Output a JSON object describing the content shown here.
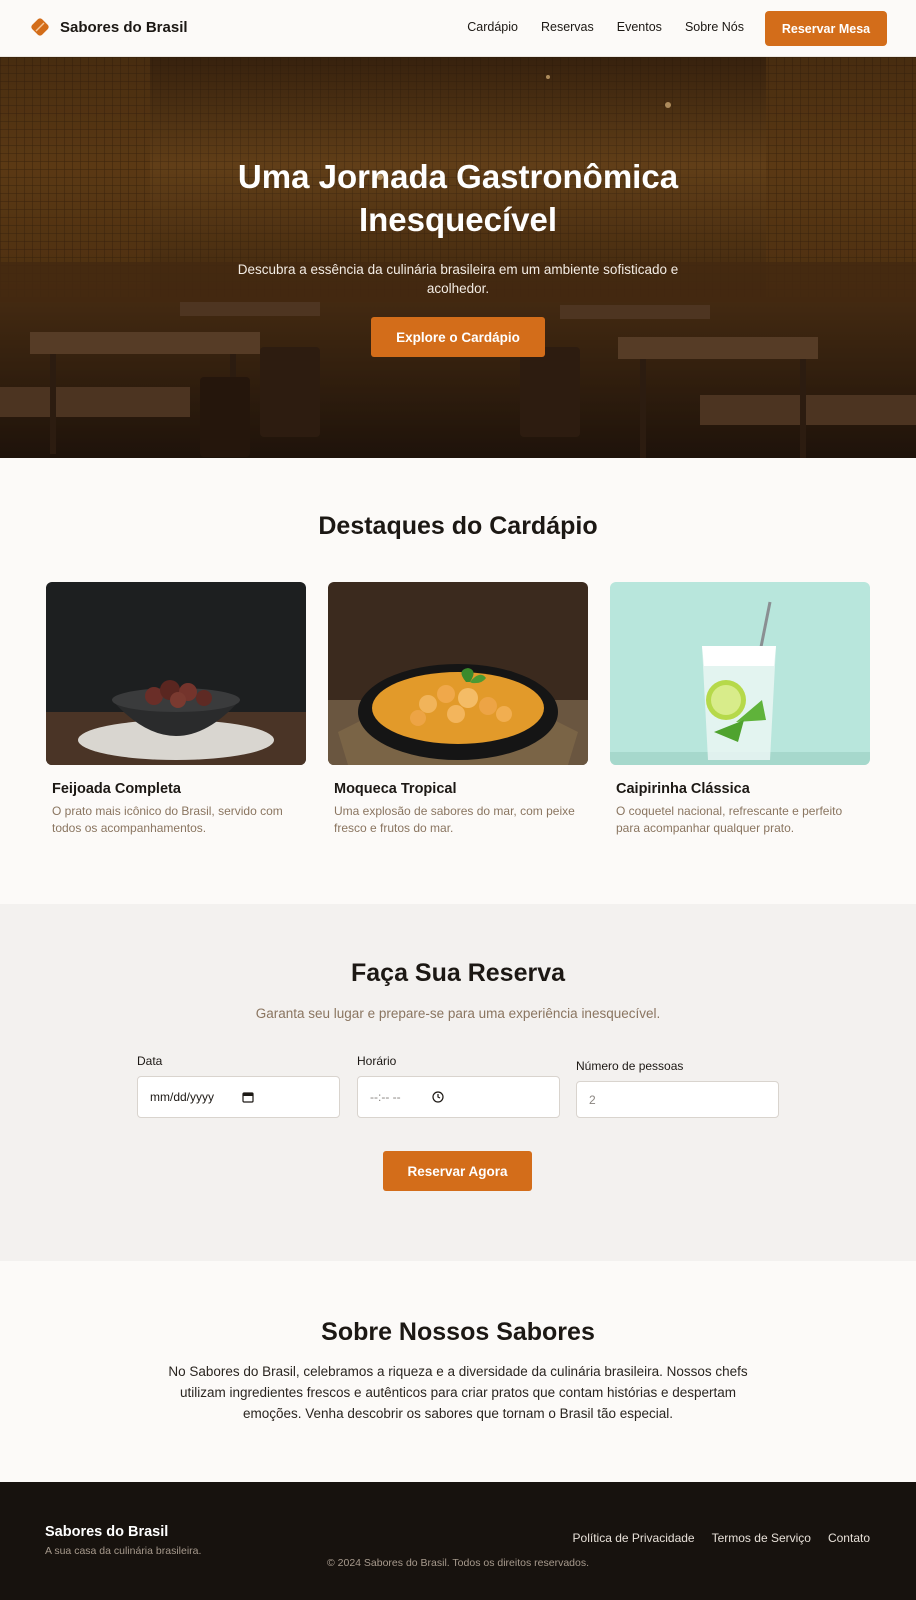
{
  "header": {
    "brand": "Sabores do Brasil",
    "nav": [
      "Cardápio",
      "Reservas",
      "Eventos",
      "Sobre Nós"
    ],
    "cta": "Reservar Mesa"
  },
  "hero": {
    "title_line1": "Uma Jornada Gastronômica",
    "title_line2": "Inesquecível",
    "subtitle": "Descubra a essência da culinária brasileira em um ambiente sofisticado e acolhedor.",
    "cta": "Explore o Cardápio"
  },
  "highlights": {
    "title": "Destaques do Cardápio",
    "items": [
      {
        "name": "Feijoada Completa",
        "description": "O prato mais icônico do Brasil, servido com todos os acompanhamentos."
      },
      {
        "name": "Moqueca Tropical",
        "description": "Uma explosão de sabores do mar, com peixe fresco e frutos do mar."
      },
      {
        "name": "Caipirinha Clássica",
        "description": "O coquetel nacional, refrescante e perfeito para acompanhar qualquer prato."
      }
    ]
  },
  "reservation": {
    "title": "Faça Sua Reserva",
    "subtitle": "Garanta seu lugar e prepare-se para uma experiência inesquecível.",
    "date_label": "Data",
    "date_placeholder": "mm/dd/yyyy",
    "time_label": "Horário",
    "time_placeholder": "--:-- --",
    "people_label": "Número de pessoas",
    "people_placeholder": "2",
    "submit": "Reservar Agora"
  },
  "about": {
    "title": "Sobre Nossos Sabores",
    "text": "No Sabores do Brasil, celebramos a riqueza e a diversidade da culinária brasileira. Nossos chefs utilizam ingredientes frescos e autênticos para criar pratos que contam histórias e despertam emoções. Venha descobrir os sabores que tornam o Brasil tão especial."
  },
  "footer": {
    "brand": "Sabores do Brasil",
    "tagline": "A sua casa da culinária brasileira.",
    "links": [
      "Política de Privacidade",
      "Termos de Serviço",
      "Contato"
    ],
    "copyright": "© 2024 Sabores do Brasil. Todos os direitos reservados."
  },
  "colors": {
    "accent": "#d36d1a",
    "background": "#fcfaf8",
    "muted_text": "#8a7560",
    "footer_bg": "#17120e"
  }
}
